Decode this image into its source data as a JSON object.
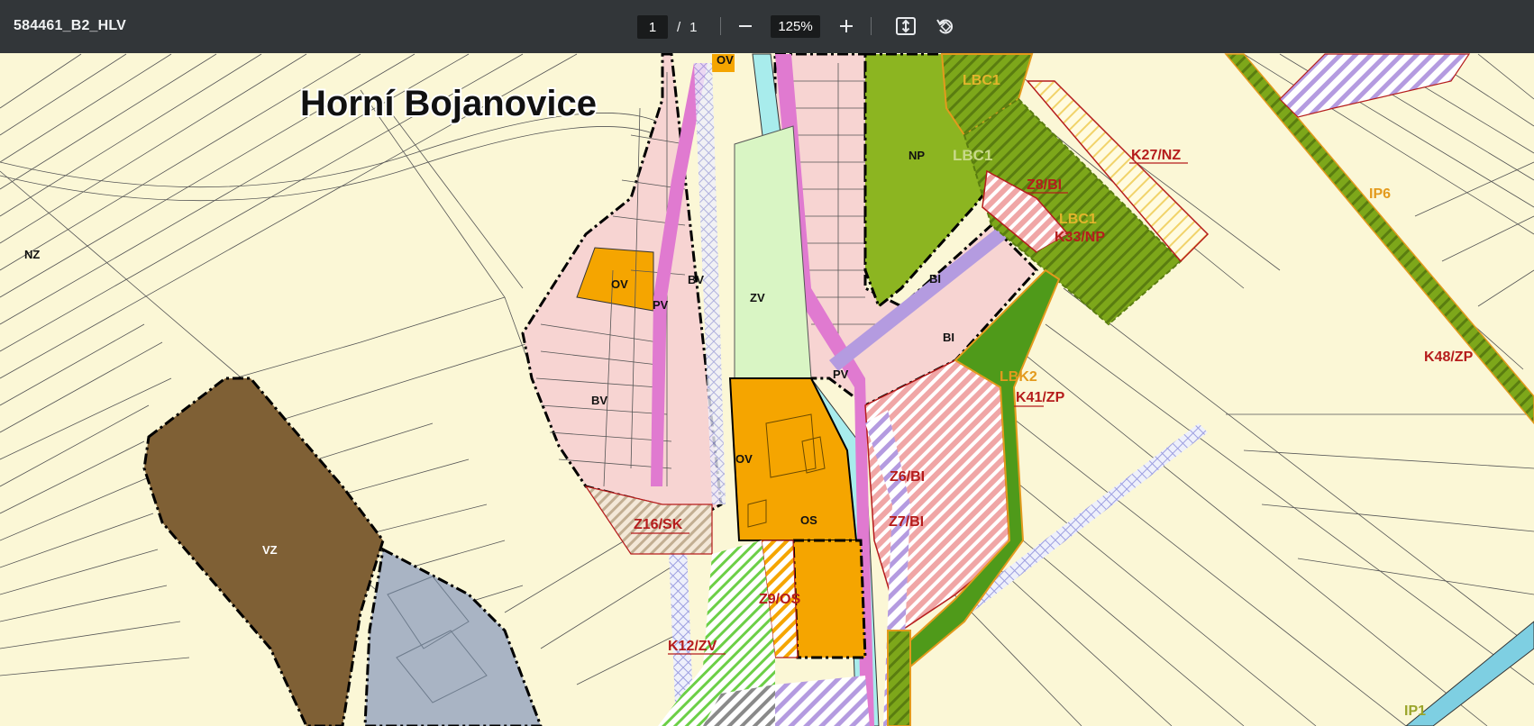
{
  "toolbar": {
    "title": "584461_B2_HLV",
    "page_current": "1",
    "page_sep": "/",
    "page_total": "1",
    "zoom": "125%",
    "icons": [
      "minus-icon",
      "plus-icon",
      "fit-page-icon",
      "rotate-icon"
    ]
  },
  "map": {
    "title": "Horní Bojanovice",
    "labels": {
      "nz": "NZ",
      "ov1": "OV",
      "ov2": "OV",
      "ov3": "OV",
      "pv1": "PV",
      "pv2": "PV",
      "bv1": "BV",
      "bv2": "BV",
      "zv": "ZV",
      "np": "NP",
      "bi1": "BI",
      "bi2": "BI",
      "os": "OS",
      "vz": "VZ",
      "lbc1a": "LBC1",
      "lbc1b": "LBC1",
      "lbc1c": "LBC1",
      "k27": "K27/NZ",
      "z8": "Z8/BI",
      "k33": "K33/NP",
      "ip6": "IP6",
      "k48": "K48/ZP",
      "lbk2": "LBK2",
      "k41": "K41/ZP",
      "z6": "Z6/BI",
      "z7": "Z7/BI",
      "z16": "Z16/SK",
      "z9": "Z9/OS",
      "k12": "K12/ZV",
      "ip1": "IP1"
    },
    "colors": {
      "background": "#fbf7d6",
      "residential": "#f7d4d2",
      "civic": "#f5a500",
      "green": "#d9f5c4",
      "nature": "#8cb521",
      "production": "#7f6035",
      "transport": "#a9b4c4",
      "street": "#e07ad0",
      "water": "#a8ecec",
      "proposal_red": "#b51c1c",
      "proposal_orange": "#e39a1d"
    }
  }
}
